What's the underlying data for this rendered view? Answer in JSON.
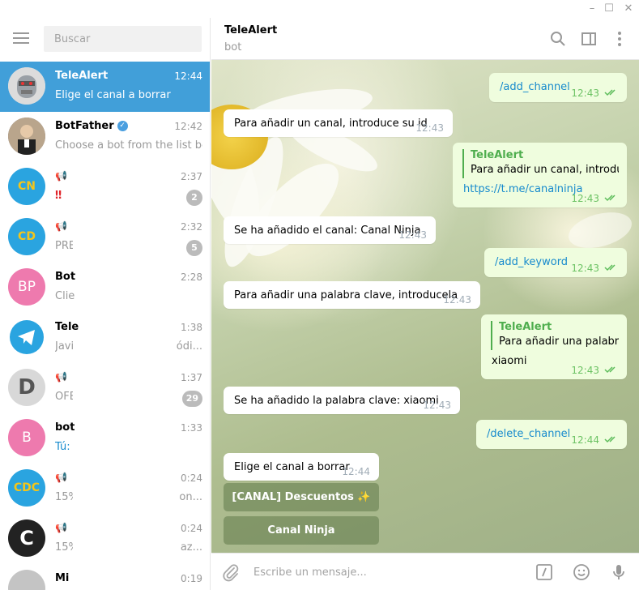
{
  "window": {
    "minimize": "–",
    "maximize": "☐",
    "close": "✕"
  },
  "sidebar": {
    "search_placeholder": "Buscar",
    "chats": [
      {
        "name": "TeleAlert",
        "time": "12:44",
        "preview": "Elige el canal a borrar",
        "active": true,
        "avatar": "robot"
      },
      {
        "name": "BotFather",
        "time": "12:42",
        "preview": "Choose a bot from the list be...",
        "verified": true,
        "avatar": "botfather"
      },
      {
        "name": "",
        "time": "2:37",
        "preview": "‼",
        "badge": "2",
        "avatar_text": "CN",
        "channel": true
      },
      {
        "name": "",
        "time": "2:32",
        "preview": "PRE",
        "badge": "5",
        "avatar_text": "CD",
        "channel": true
      },
      {
        "name": "Bot",
        "time": "2:28",
        "preview": "Clie",
        "avatar_text": "BP",
        "avatar_color": "#ee7aae"
      },
      {
        "name": "Tele",
        "time": "1:38",
        "preview": "Javi",
        "preview_right": "ódi...",
        "avatar": "telegram"
      },
      {
        "name": "",
        "time": "1:37",
        "preview": "OFE",
        "badge": "29",
        "avatar_text": "D",
        "channel": true
      },
      {
        "name": "bot",
        "time": "1:33",
        "preview": "Tú:",
        "avatar_text": "B",
        "avatar_color": "#ee7aae"
      },
      {
        "name": "",
        "time": "0:24",
        "preview": "15%",
        "preview_right": "on...",
        "avatar_text": "CDC",
        "channel": true
      },
      {
        "name": "",
        "time": "0:24",
        "preview": "15%",
        "preview_right": "az...",
        "avatar_text": "C",
        "channel": true
      },
      {
        "name": "Mi",
        "time": "0:19",
        "preview": "",
        "avatar_text": ""
      }
    ]
  },
  "chat": {
    "title": "TeleAlert",
    "status": "bot",
    "messages": [
      {
        "dir": "out",
        "text": "/add_channel",
        "time": "12:43"
      },
      {
        "dir": "in",
        "text": "Para añadir un canal, introduce su id",
        "time": "12:43"
      },
      {
        "dir": "out",
        "reply_name": "TeleAlert",
        "reply_text": "Para añadir un canal, introduc...",
        "text": "https://t.me/canalninja",
        "time": "12:43"
      },
      {
        "dir": "in",
        "text": "Se ha añadido el canal: Canal Ninja",
        "time": "12:43"
      },
      {
        "dir": "out",
        "text": "/add_keyword",
        "time": "12:43"
      },
      {
        "dir": "in",
        "text": "Para añadir una palabra clave, introducela",
        "time": "12:43"
      },
      {
        "dir": "out",
        "reply_name": "TeleAlert",
        "reply_text": "Para añadir una palabr...",
        "text": "xiaomi",
        "time": "12:43"
      },
      {
        "dir": "in",
        "text": "Se ha añadido la palabra clave: xiaomi",
        "time": "12:43"
      },
      {
        "dir": "out",
        "text": "/delete_channel",
        "time": "12:44"
      },
      {
        "dir": "in",
        "text": "Elige el canal a borrar",
        "time": "12:44"
      }
    ],
    "keyboard": [
      "[CANAL] Descuentos ✨",
      "Canal Ninja"
    ]
  },
  "composer": {
    "placeholder": "Escribe un mensaje..."
  },
  "colors": {
    "accent": "#419fd9",
    "outgoing_bubble": "#effdde",
    "link": "#168acd",
    "reply": "#4fae4e"
  }
}
